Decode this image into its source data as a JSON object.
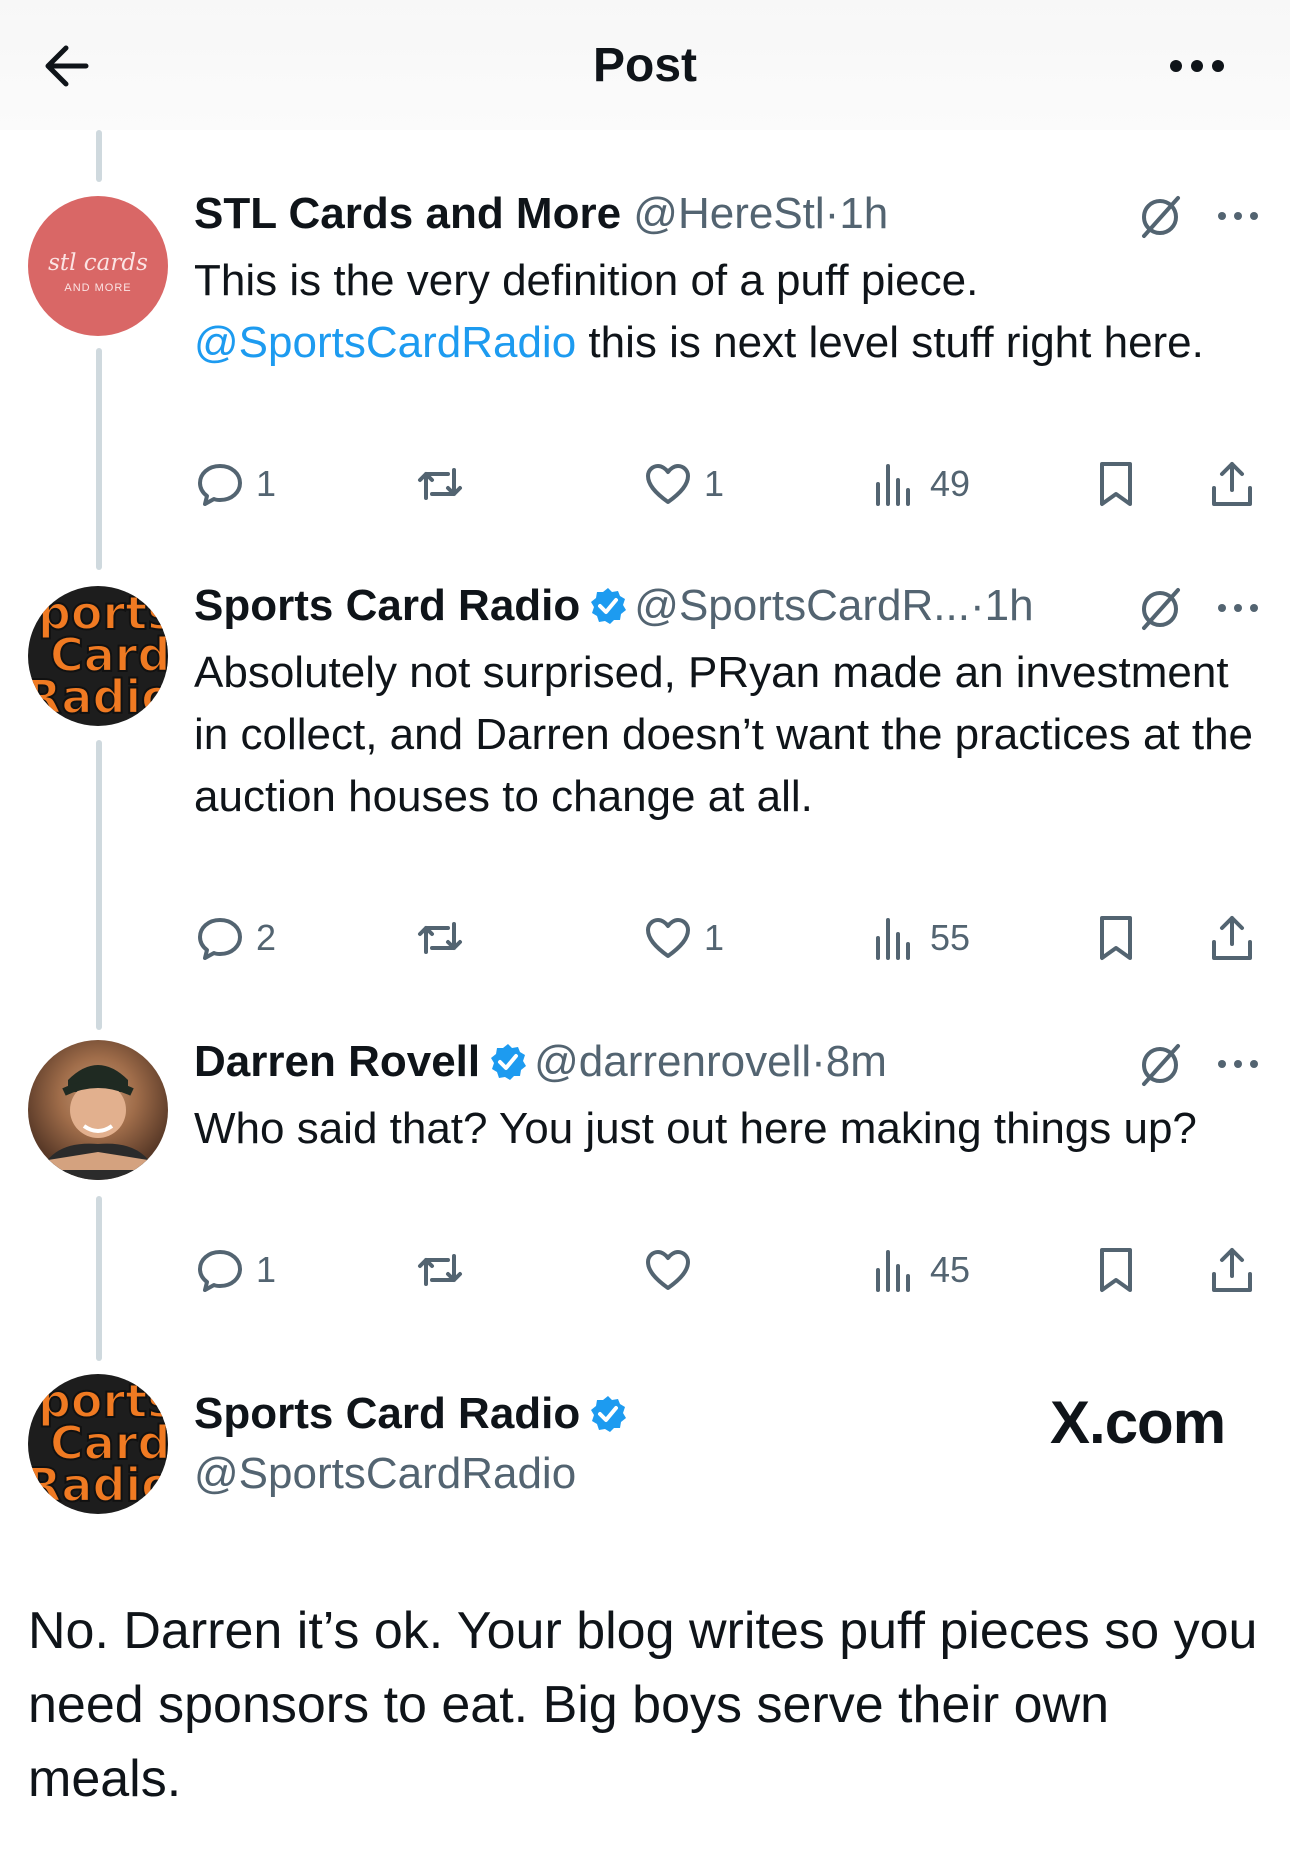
{
  "header": {
    "title": "Post",
    "back_icon": "back-arrow-icon",
    "more_icon": "more-icon"
  },
  "tweets": [
    {
      "name": "STL Cards and More",
      "handle": "@HereStl",
      "sep": "·",
      "time": "1h",
      "verified": false,
      "avatar_text": [
        "stl cards",
        "AND MORE"
      ],
      "text_parts": [
        "This is the very definition of a puff piece.",
        "@SportsCardRadio",
        " this is next level stuff right here."
      ],
      "replies": "1",
      "reposts": "",
      "likes": "1",
      "views": "49"
    },
    {
      "name": "Sports Card Radio",
      "handle": "@SportsCardR...",
      "sep": "·",
      "time": "1h",
      "verified": true,
      "avatar_text": [
        "ports",
        "Card",
        "Radio"
      ],
      "text": "Absolutely not surprised, PRyan made an investment in collect, and Darren doesn’t want the practices at the auction houses to change at all.",
      "replies": "2",
      "reposts": "",
      "likes": "1",
      "views": "55"
    },
    {
      "name": "Darren Rovell",
      "handle": "@darrenrovell",
      "sep": "·",
      "time": "8m",
      "verified": true,
      "text": "Who said that? You just out here making things up?",
      "replies": "1",
      "reposts": "",
      "likes": "",
      "views": "45"
    }
  ],
  "final": {
    "name": "Sports Card Radio",
    "handle": "@SportsCardRadio",
    "verified": true,
    "brand": "X.com",
    "avatar_text": [
      "ports",
      "Card",
      "Radio"
    ],
    "text": "No. Darren it’s ok. Your blog writes puff pieces so you need sponsors to eat. Big boys serve their own meals."
  },
  "colors": {
    "link": "#1d9bf0",
    "muted": "#536471",
    "verified": "#1d9bf0",
    "avatar_orange": "#f07a22",
    "stl_pink": "#d96766"
  }
}
